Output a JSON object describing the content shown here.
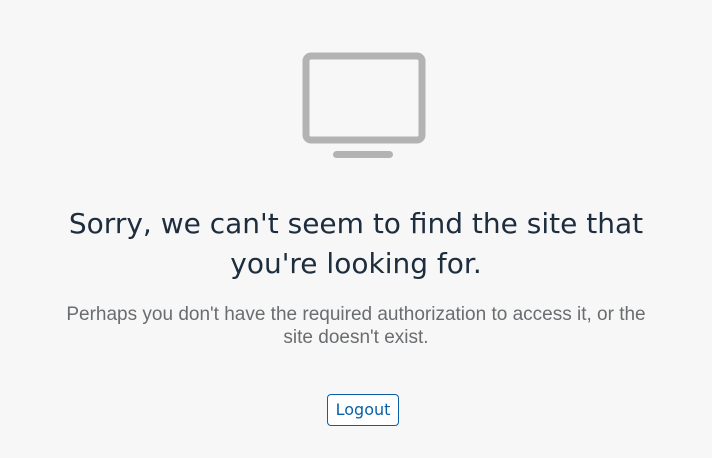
{
  "error": {
    "illustration_icon": "monitor-icon",
    "headline": "Sorry, we can't seem to find the site that you're looking for.",
    "description": "Perhaps you don't have the required authorization to access it, or the site doesn't exist."
  },
  "actions": {
    "logout_label": "Logout"
  },
  "colors": {
    "background": "#f7f7f7",
    "icon": "#b3b3b3",
    "headline": "#1d2d3e",
    "description": "#6a6d70",
    "button_accent": "#0b5fa8"
  }
}
